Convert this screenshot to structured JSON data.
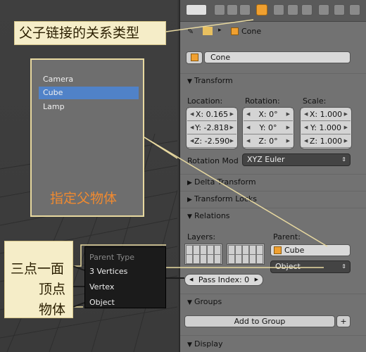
{
  "annotations": {
    "parent_type_label": "父子链接的关系类型",
    "specify_parent": "指定父物体",
    "three_vertices_cn": "三点一面",
    "vertex_cn": "顶点",
    "object_cn": "物体"
  },
  "object_list": {
    "items": [
      "Camera",
      "Cube",
      "Lamp"
    ],
    "selected": "Cube"
  },
  "parent_type_menu": {
    "title": "Parent Type",
    "items": [
      "3 Vertices",
      "Vertex",
      "Object"
    ]
  },
  "properties": {
    "breadcrumb": "Cone",
    "object_name": "Cone",
    "transform": {
      "title": "Transform",
      "location_label": "Location:",
      "rotation_label": "Rotation:",
      "scale_label": "Scale:",
      "location": [
        "X: 0.165",
        "Y: -2.818",
        "Z: -2.590"
      ],
      "rotation": [
        "X: 0°",
        "Y: 0°",
        "Z: 0°"
      ],
      "scale": [
        "X: 1.000",
        "Y: 1.000",
        "Z: 1.000"
      ],
      "rotation_mode_label": "Rotation Mod",
      "rotation_mode": "XYZ Euler"
    },
    "delta_transform": "Delta Transform",
    "transform_locks": "Transform Locks",
    "relations": {
      "title": "Relations",
      "layers_label": "Layers:",
      "parent_label": "Parent:",
      "parent_value": "Cube",
      "parent_type_value": "Object",
      "pass_index": "Pass Index: 0"
    },
    "groups": {
      "title": "Groups",
      "add_to_group": "Add to Group"
    },
    "display": "Display"
  },
  "colors": {
    "accent_orange": "#f0a030",
    "selection_blue": "#5082c8",
    "annotation_bg": "#f5edc8"
  }
}
